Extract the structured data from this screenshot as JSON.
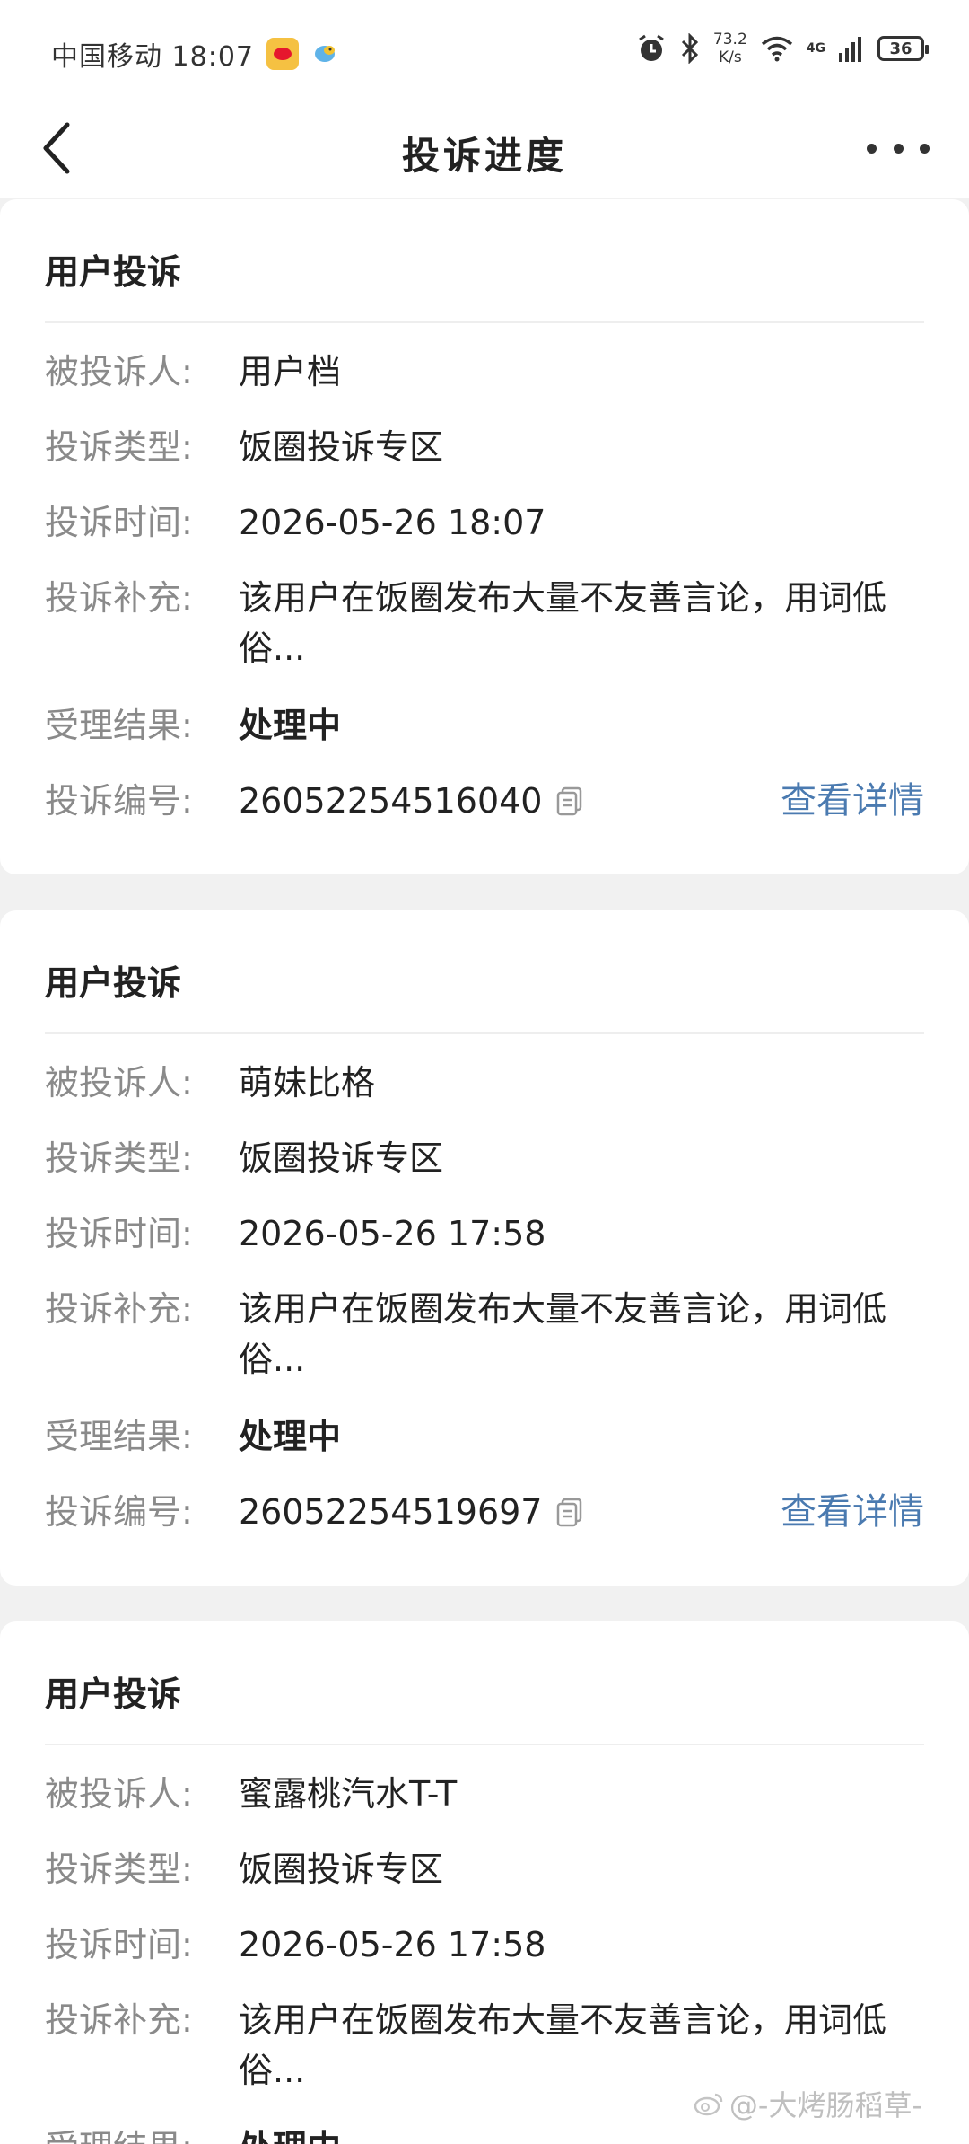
{
  "status_bar": {
    "carrier_time": "中国移动 18:07",
    "speed_value": "73.2",
    "speed_unit": "K/s",
    "network": "4G",
    "battery": "36"
  },
  "nav": {
    "title": "投诉进度"
  },
  "labels": {
    "card_title": "用户投诉",
    "respondent": "被投诉人:",
    "type": "投诉类型:",
    "time": "投诉时间:",
    "supplement": "投诉补充:",
    "result": "受理结果:",
    "number": "投诉编号:",
    "detail_link": "查看详情"
  },
  "complaints": [
    {
      "respondent": "用户档",
      "type": "饭圈投诉专区",
      "time": "2026-05-26 18:07",
      "supplement": "该用户在饭圈发布大量不友善言论，用词低俗...",
      "result": "处理中",
      "number": "26052254516040"
    },
    {
      "respondent": "萌妹比格",
      "type": "饭圈投诉专区",
      "time": "2026-05-26 17:58",
      "supplement": "该用户在饭圈发布大量不友善言论，用词低俗...",
      "result": "处理中",
      "number": "26052254519697"
    },
    {
      "respondent": "蜜露桃汽水T-T",
      "type": "饭圈投诉专区",
      "time": "2026-05-26 17:58",
      "supplement": "该用户在饭圈发布大量不友善言论，用词低俗...",
      "result": "处理中"
    }
  ],
  "watermark": "@-大烤肠稻草-"
}
